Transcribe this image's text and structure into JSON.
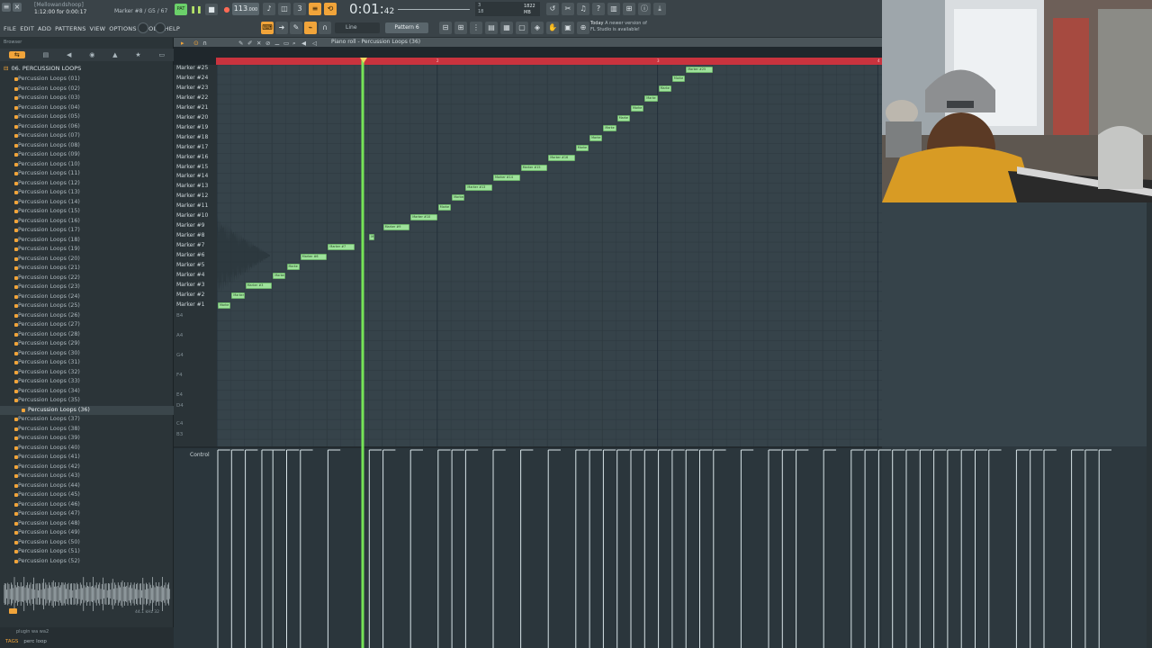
{
  "project": {
    "name": "[Mellowandshoop]",
    "time_line": "1:12:00 for 0:00:17",
    "marker_info": "Marker #8 / G5 / 67"
  },
  "transport": {
    "pat_label": "PAT",
    "tempo": "113",
    "tempo_dec": ".000",
    "clock_main": "0:01",
    "clock_sub": "42",
    "cpu_line1": "3",
    "cpu_line2": "18",
    "memory": "1822 MB"
  },
  "menu": [
    "FILE",
    "EDIT",
    "ADD",
    "PATTERNS",
    "VIEW",
    "OPTIONS",
    "TOOLS",
    "HELP"
  ],
  "toolbar": {
    "snap_label": "Line",
    "pattern": "Pattern 6",
    "news_day": "Today",
    "news_text": "A newer version of",
    "news_text2": "FL Studio is available!"
  },
  "browser": {
    "label": "Browser",
    "folder": "06. PERCUSSION LOOPS",
    "items": [
      "Percussion Loops (01)",
      "Percussion Loops (02)",
      "Percussion Loops (03)",
      "Percussion Loops (04)",
      "Percussion Loops (05)",
      "Percussion Loops (06)",
      "Percussion Loops (07)",
      "Percussion Loops (08)",
      "Percussion Loops (09)",
      "Percussion Loops (10)",
      "Percussion Loops (11)",
      "Percussion Loops (12)",
      "Percussion Loops (13)",
      "Percussion Loops (14)",
      "Percussion Loops (15)",
      "Percussion Loops (16)",
      "Percussion Loops (17)",
      "Percussion Loops (18)",
      "Percussion Loops (19)",
      "Percussion Loops (20)",
      "Percussion Loops (21)",
      "Percussion Loops (22)",
      "Percussion Loops (23)",
      "Percussion Loops (24)",
      "Percussion Loops (25)",
      "Percussion Loops (26)",
      "Percussion Loops (27)",
      "Percussion Loops (28)",
      "Percussion Loops (29)",
      "Percussion Loops (30)",
      "Percussion Loops (31)",
      "Percussion Loops (32)",
      "Percussion Loops (33)",
      "Percussion Loops (34)",
      "Percussion Loops (35)",
      "Percussion Loops (36)",
      "Percussion Loops (37)",
      "Percussion Loops (38)",
      "Percussion Loops (39)",
      "Percussion Loops (40)",
      "Percussion Loops (41)",
      "Percussion Loops (42)",
      "Percussion Loops (43)",
      "Percussion Loops (44)",
      "Percussion Loops (45)",
      "Percussion Loops (46)",
      "Percussion Loops (47)",
      "Percussion Loops (48)",
      "Percussion Loops (49)",
      "Percussion Loops (50)",
      "Percussion Loops (51)",
      "Percussion Loops (52)"
    ],
    "selected_index": 35,
    "wave_info": "44.1 kHz 32",
    "tags_line": "plugin    wa    wa2",
    "tags_label": "TAGS",
    "tags_value": "perc loop"
  },
  "piano_roll": {
    "title": "Piano roll - Percussion Loops (36)",
    "timeline_ticks": [
      "1",
      "2",
      "3",
      "4"
    ],
    "control_label": "Control",
    "key_rows": [
      "Marker #25",
      "Marker #24",
      "Marker #23",
      "Marker #22",
      "Marker #21",
      "Marker #20",
      "Marker #19",
      "Marker #18",
      "Marker #17",
      "Marker #16",
      "Marker #15",
      "Marker #14",
      "Marker #13",
      "Marker #12",
      "Marker #11",
      "Marker #10",
      "Marker #9",
      "Marker #8",
      "Marker #7",
      "Marker #6",
      "Marker #5",
      "Marker #4",
      "Marker #3",
      "Marker #2",
      "Marker #1"
    ],
    "octave_labels": [
      "B4",
      "A4",
      "G4",
      "F4",
      "E4",
      "D4",
      "C4",
      "B3"
    ],
    "notes": [
      {
        "label": "Marke",
        "row": 25,
        "step": 0,
        "len": 1
      },
      {
        "label": "Marker",
        "row": 24,
        "step": 1,
        "len": 1
      },
      {
        "label": "Marker #3",
        "row": 23,
        "step": 2,
        "len": 2
      },
      {
        "label": "Marker",
        "row": 22,
        "step": 4,
        "len": 1
      },
      {
        "label": "Marke",
        "row": 21,
        "step": 5,
        "len": 1
      },
      {
        "label": "Marker #6",
        "row": 20,
        "step": 6,
        "len": 2
      },
      {
        "label": "Marker #7",
        "row": 19,
        "step": 8,
        "len": 2
      },
      {
        "label": "M",
        "row": 18,
        "step": 11,
        "len": 0.4
      },
      {
        "label": "Marker #9",
        "row": 17,
        "step": 12,
        "len": 2
      },
      {
        "label": "Marker #10",
        "row": 16,
        "step": 14,
        "len": 2
      },
      {
        "label": "Marke",
        "row": 15,
        "step": 16,
        "len": 1
      },
      {
        "label": "Marker",
        "row": 14,
        "step": 17,
        "len": 1
      },
      {
        "label": "Marker #13",
        "row": 13,
        "step": 18,
        "len": 2
      },
      {
        "label": "Marker #14",
        "row": 12,
        "step": 20,
        "len": 2
      },
      {
        "label": "Marker #15",
        "row": 11,
        "step": 22,
        "len": 2
      },
      {
        "label": "Marker #16",
        "row": 10,
        "step": 24,
        "len": 2
      },
      {
        "label": "Marke",
        "row": 9,
        "step": 26,
        "len": 1
      },
      {
        "label": "Marke",
        "row": 8,
        "step": 27,
        "len": 1
      },
      {
        "label": "Marke",
        "row": 7,
        "step": 28,
        "len": 1
      },
      {
        "label": "Marke",
        "row": 6,
        "step": 29,
        "len": 1
      },
      {
        "label": "Marke",
        "row": 5,
        "step": 30,
        "len": 1
      },
      {
        "label": "Marke",
        "row": 4,
        "step": 31,
        "len": 1
      },
      {
        "label": "Marke",
        "row": 3,
        "step": 32,
        "len": 1
      },
      {
        "label": "Marke",
        "row": 2,
        "step": 33,
        "len": 1
      },
      {
        "label": "Marker #25",
        "row": 1,
        "step": 34,
        "len": 2
      }
    ],
    "velocity_steps": [
      0,
      1,
      2,
      3.2,
      4,
      5,
      6,
      8,
      11,
      12,
      14,
      16,
      17,
      18,
      20,
      22,
      24,
      26,
      27,
      28,
      29,
      30,
      31,
      32,
      33,
      34,
      35,
      36,
      38,
      40,
      41,
      42,
      44,
      46,
      47,
      48,
      49,
      50,
      51,
      52,
      53,
      54,
      55,
      56,
      58,
      59,
      60,
      62,
      63,
      64
    ],
    "velocity_value": 1.0
  },
  "colors": {
    "note_fill": "#9ee29b",
    "playhead": "#7cf25a",
    "timeline": "#c9333e",
    "accent": "#f1a43a"
  }
}
